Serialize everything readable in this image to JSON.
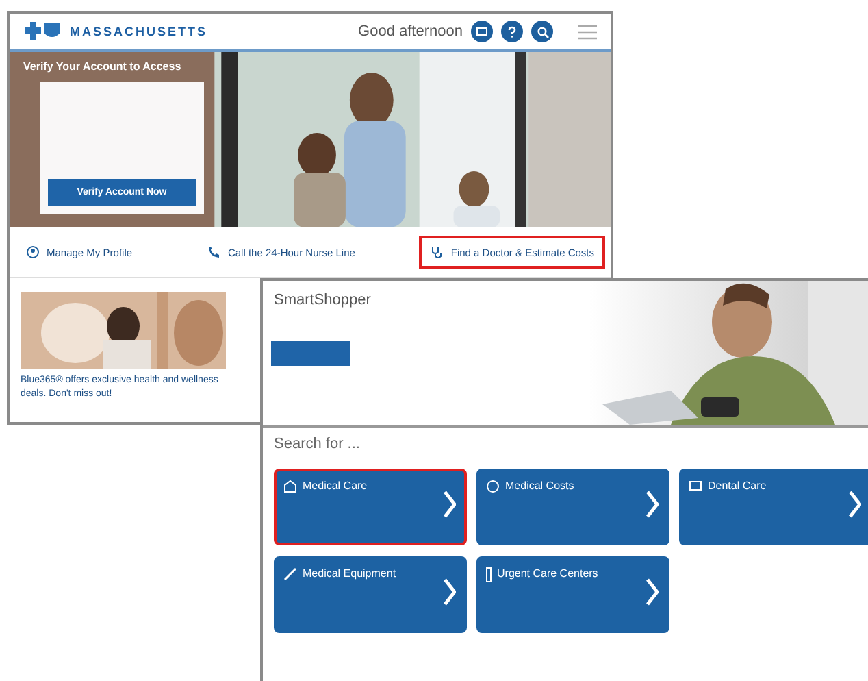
{
  "home_window": {
    "brand": "MASSACHUSETTS",
    "greeting": "Good afternoon",
    "hero": {
      "kind": "picture",
      "card_title": "Verify Your Account to Access",
      "button": "Verify Account Now"
    },
    "quick_links": [
      {
        "label": "Manage My Profile",
        "highlighted": false
      },
      {
        "label": "Call the 24-Hour Nurse Line",
        "highlighted": false
      },
      {
        "label": "Find a Doctor & Estimate Costs",
        "highlighted": true
      }
    ],
    "promos": [
      {
        "kind": "picture",
        "caption": "Blue365® offers exclusive health and wellness deals. Don't miss out!"
      }
    ]
  },
  "shopper_window": {
    "title": "SmartShopper",
    "section_heading": "Search for ...",
    "cards": [
      {
        "title": "Medical Care",
        "highlighted": true
      },
      {
        "title": "Medical Costs",
        "highlighted": false
      },
      {
        "title": "Dental Care",
        "highlighted": false
      },
      {
        "title": "Medical Equipment",
        "highlighted": false
      },
      {
        "title": "Urgent Care Centers",
        "highlighted": false
      }
    ]
  }
}
